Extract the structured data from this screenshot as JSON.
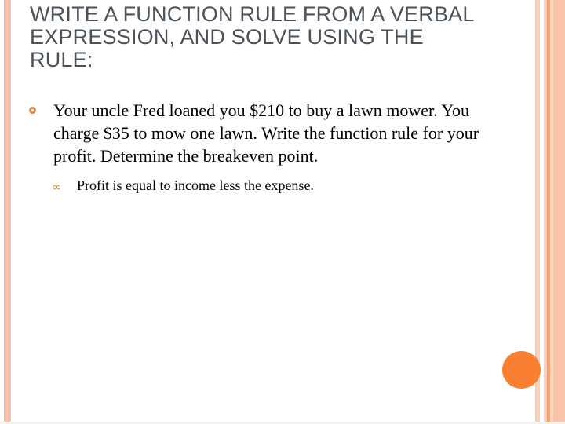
{
  "slide": {
    "title": "WRITE A FUNCTION RULE FROM A VERBAL EXPRESSION, AND SOLVE USING THE RULE:",
    "bullets": [
      {
        "level": 1,
        "marker": "ring-bullet",
        "text": "Your uncle Fred loaned you $210 to buy a lawn mower.  You charge $35 to mow one lawn.  Write the function rule for your profit.  Determine the breakeven point."
      },
      {
        "level": 2,
        "marker": "aldus-leaf-bullet",
        "marker_glyph": "∞",
        "text": "Profit is equal to income less the expense."
      }
    ],
    "decorations": {
      "accent_circle": "orange-circle",
      "left_rule": "left-edge-stripe",
      "right_bands": "right-edge-stripes",
      "bottom_rule": "bottom-hairline"
    },
    "colors": {
      "title_text": "#4b5159",
      "body_text": "#000000",
      "accent_orange": "#f98033",
      "bullet_ring": "#e08a45",
      "leaf_bullet": "#c08a4a",
      "stripe_salmon": "#f6c4ae",
      "stripe_deep": "#f2a171",
      "background": "#ffffff"
    }
  }
}
